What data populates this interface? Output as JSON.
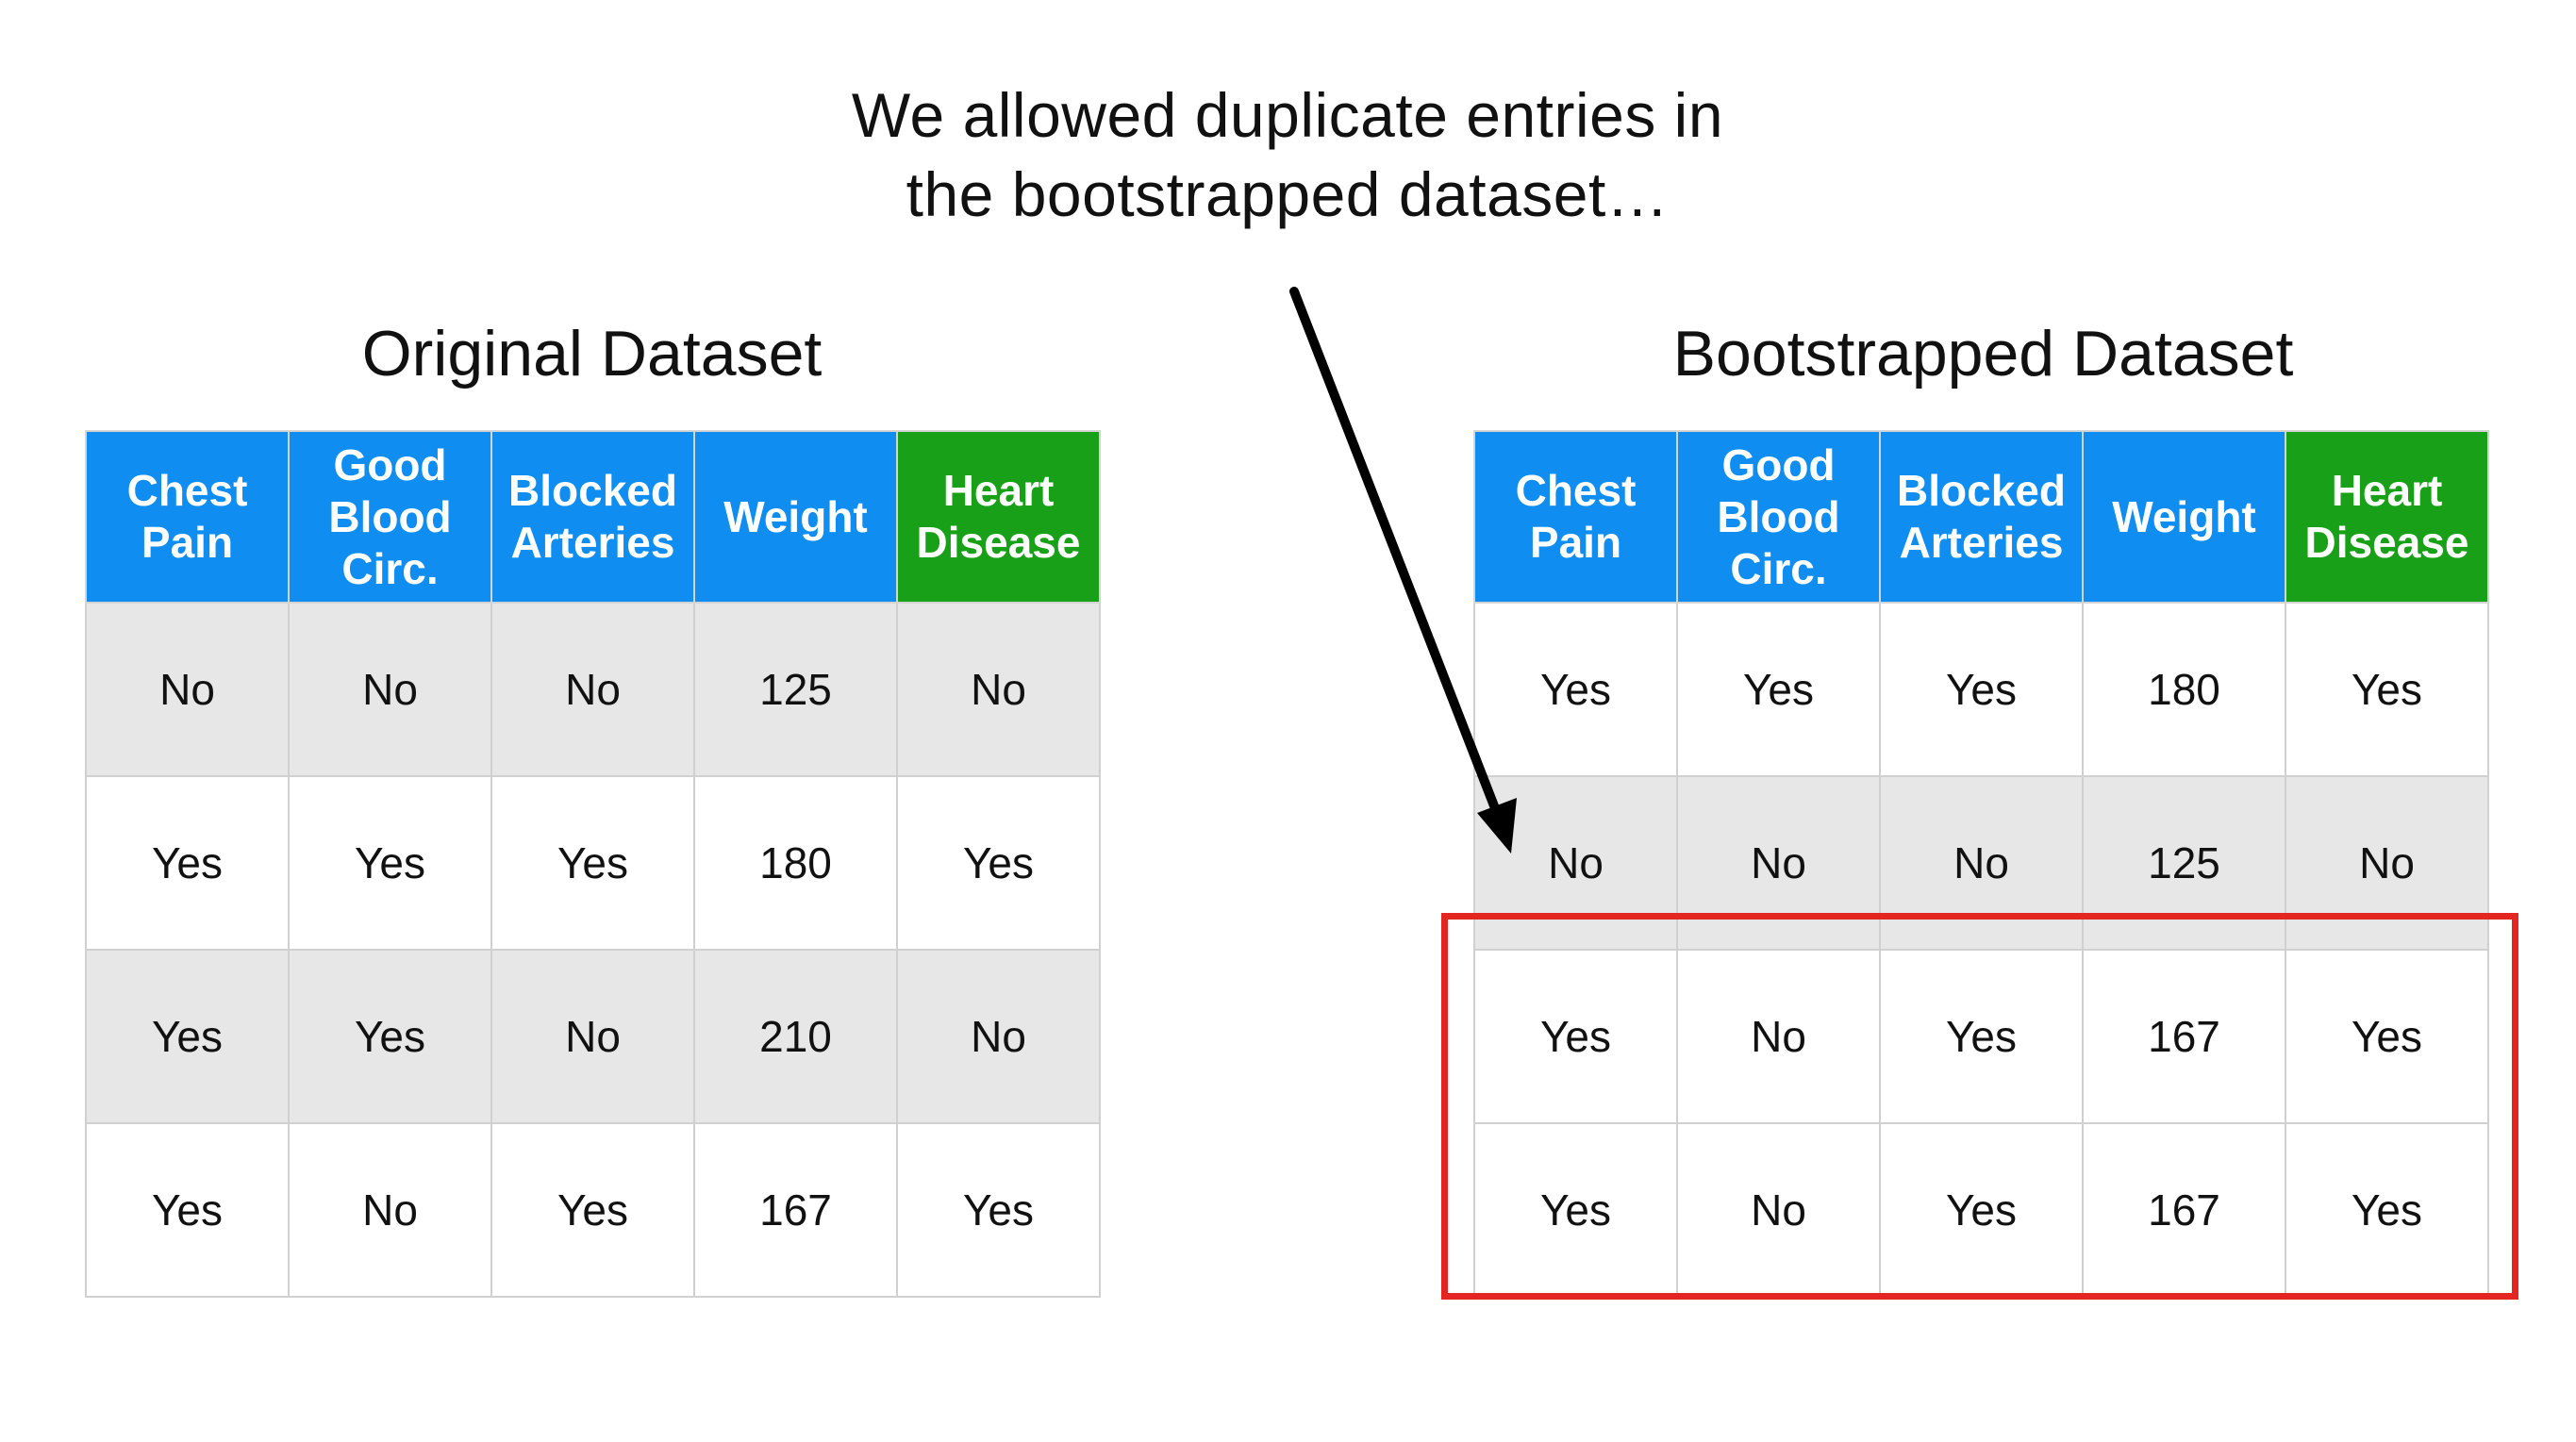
{
  "caption": {
    "line1": "We allowed duplicate entries in",
    "line2": "the bootstrapped dataset…"
  },
  "colors": {
    "header": "#0f8df0",
    "target_header": "#18a118",
    "highlight": "#e3261f",
    "shaded_row": "#e7e7e7"
  },
  "headers": {
    "chest_pain": [
      "Chest",
      "Pain"
    ],
    "good_blood_circ": [
      "Good",
      "Blood",
      "Circ."
    ],
    "blocked_arteries": [
      "Blocked",
      "Arteries"
    ],
    "weight": [
      "Weight"
    ],
    "heart_disease": [
      "Heart",
      "Disease"
    ]
  },
  "original": {
    "title": "Original Dataset",
    "rows": [
      [
        "No",
        "No",
        "No",
        "125",
        "No"
      ],
      [
        "Yes",
        "Yes",
        "Yes",
        "180",
        "Yes"
      ],
      [
        "Yes",
        "Yes",
        "No",
        "210",
        "No"
      ],
      [
        "Yes",
        "No",
        "Yes",
        "167",
        "Yes"
      ]
    ]
  },
  "bootstrapped": {
    "title": "Bootstrapped Dataset",
    "rows": [
      [
        "Yes",
        "Yes",
        "Yes",
        "180",
        "Yes"
      ],
      [
        "No",
        "No",
        "No",
        "125",
        "No"
      ],
      [
        "Yes",
        "No",
        "Yes",
        "167",
        "Yes"
      ],
      [
        "Yes",
        "No",
        "Yes",
        "167",
        "Yes"
      ]
    ]
  }
}
